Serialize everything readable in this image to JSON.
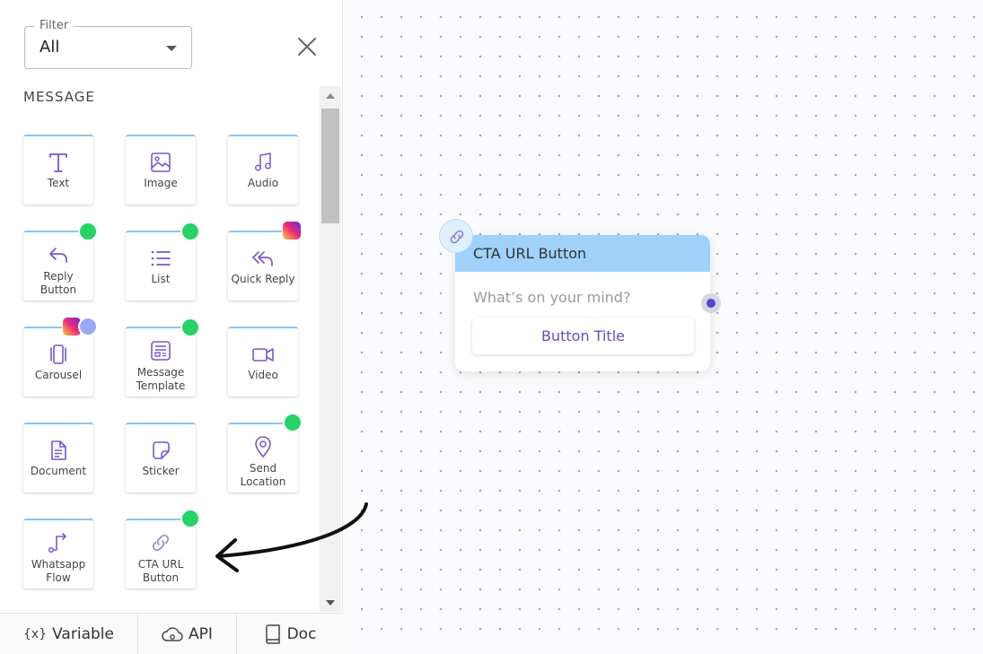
{
  "filter": {
    "label": "Filter",
    "value": "All"
  },
  "section": {
    "title": "MESSAGE"
  },
  "tiles": [
    {
      "label": "Text",
      "icon": "text-icon"
    },
    {
      "label": "Image",
      "icon": "image-icon"
    },
    {
      "label": "Audio",
      "icon": "audio-icon"
    },
    {
      "label": "Reply Button",
      "icon": "reply-icon",
      "badge": "whatsapp"
    },
    {
      "label": "List",
      "icon": "list-icon",
      "badge": "whatsapp"
    },
    {
      "label": "Quick Reply",
      "icon": "reply-all-icon",
      "badge": "instagram"
    },
    {
      "label": "Carousel",
      "icon": "carousel-icon",
      "badge": "instagram+web"
    },
    {
      "label": "Message Template",
      "icon": "template-icon",
      "badge": "whatsapp"
    },
    {
      "label": "Video",
      "icon": "video-icon"
    },
    {
      "label": "Document",
      "icon": "document-icon"
    },
    {
      "label": "Sticker",
      "icon": "sticker-icon"
    },
    {
      "label": "Send Location",
      "icon": "location-icon",
      "badge": "whatsapp"
    },
    {
      "label": "Whatsapp Flow",
      "icon": "flow-icon"
    },
    {
      "label": "CTA URL Button",
      "icon": "link-icon",
      "badge": "whatsapp"
    }
  ],
  "bottom_bar": {
    "variable": "Variable",
    "variable_glyph": "{x}",
    "api": "API",
    "doc": "Doc"
  },
  "node": {
    "title": "CTA URL Button",
    "message_placeholder": "What’s on your mind?",
    "button_title": "Button Title"
  },
  "colors": {
    "accent": "#5048d8",
    "tile_border": "#8fc5ee",
    "node_header": "#9fd1fb",
    "icon": "#7a56c9"
  }
}
